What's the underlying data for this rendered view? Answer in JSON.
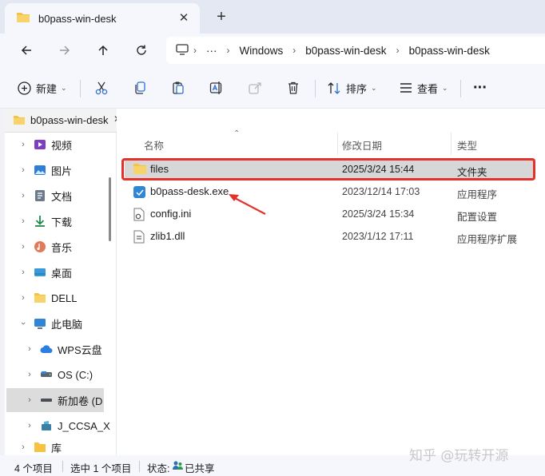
{
  "window": {
    "tab_title": "b0pass-win-desk",
    "tab_close": "✕",
    "new_tab": "+"
  },
  "nav": {
    "more": "···",
    "breadcrumb": [
      "Windows",
      "b0pass-win-desk",
      "b0pass-win-desk"
    ]
  },
  "toolbar": {
    "new_label": "新建",
    "sort_label": "排序",
    "view_label": "查看",
    "more": "···"
  },
  "pinned_tab": {
    "label": "b0pass-win-desk",
    "close": "✕"
  },
  "sidebar": {
    "items": [
      {
        "label": "视频",
        "icon": "video-icon"
      },
      {
        "label": "图片",
        "icon": "pictures-icon"
      },
      {
        "label": "文档",
        "icon": "documents-icon"
      },
      {
        "label": "下载",
        "icon": "download-icon"
      },
      {
        "label": "音乐",
        "icon": "music-icon"
      },
      {
        "label": "桌面",
        "icon": "desktop-icon"
      },
      {
        "label": "DELL",
        "icon": "folder-icon"
      },
      {
        "label": "此电脑",
        "icon": "this-pc-icon"
      },
      {
        "label": "WPS云盘",
        "icon": "cloud-icon"
      },
      {
        "label": "OS (C:)",
        "icon": "drive-icon"
      },
      {
        "label": "新加卷 (D",
        "icon": "drive-icon"
      },
      {
        "label": "J_CCSA_X",
        "icon": "disc-icon"
      },
      {
        "label": "库",
        "icon": "library-icon"
      }
    ]
  },
  "columns": {
    "name": "名称",
    "date": "修改日期",
    "type": "类型"
  },
  "files": [
    {
      "name": "files",
      "date": "2025/3/24 15:44",
      "type": "文件夹",
      "icon": "folder-icon"
    },
    {
      "name": "b0pass-desk.exe",
      "date": "2023/12/14 17:03",
      "type": "应用程序",
      "icon": "app-icon"
    },
    {
      "name": "config.ini",
      "date": "2025/3/24 15:34",
      "type": "配置设置",
      "icon": "config-file-icon"
    },
    {
      "name": "zlib1.dll",
      "date": "2023/1/12 17:11",
      "type": "应用程序扩展",
      "icon": "dll-file-icon"
    }
  ],
  "status": {
    "count": "4 个项目",
    "selected": "选中 1 个项目",
    "state_label": "状态:",
    "state_value": "已共享"
  },
  "watermark": "知乎 @玩转开源",
  "colors": {
    "highlight": "#e3312c",
    "folder": "#f5c242",
    "selected_row": "#d7d7d7"
  }
}
